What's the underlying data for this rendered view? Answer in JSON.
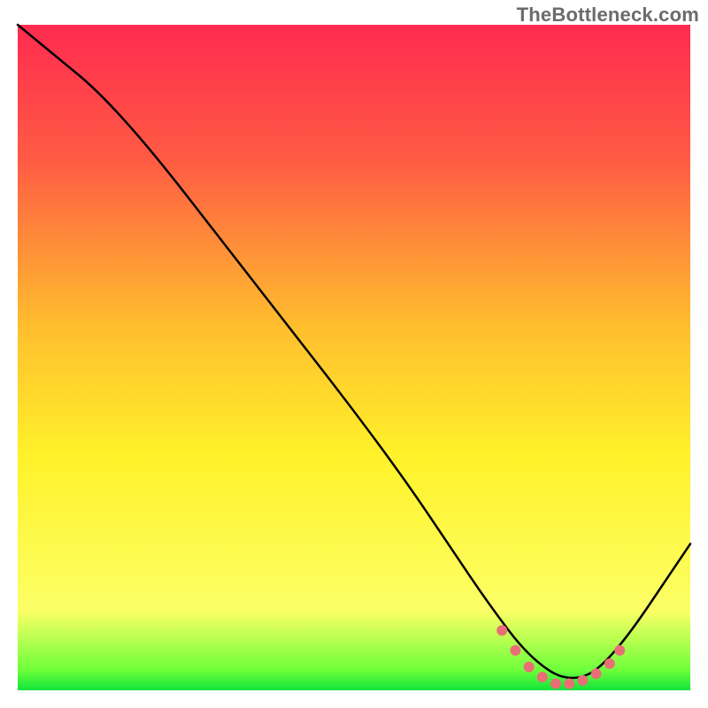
{
  "watermark": {
    "text": "TheBottleneck.com"
  },
  "chart_data": {
    "type": "line",
    "title": "",
    "xlabel": "",
    "ylabel": "",
    "xlim": [
      0,
      100
    ],
    "ylim": [
      0,
      100
    ],
    "gradient_stops": [
      {
        "offset": 0,
        "color": "#ff2b50"
      },
      {
        "offset": 20,
        "color": "#ff5a44"
      },
      {
        "offset": 45,
        "color": "#ffbd2e"
      },
      {
        "offset": 65,
        "color": "#fff22a"
      },
      {
        "offset": 88,
        "color": "#fcff66"
      },
      {
        "offset": 97,
        "color": "#6eff3a"
      },
      {
        "offset": 100,
        "color": "#10e43a"
      }
    ],
    "series": [
      {
        "name": "bottleneck-curve",
        "color": "#000000",
        "x": [
          0,
          6,
          12,
          20,
          30,
          40,
          50,
          58,
          64,
          70,
          76,
          82,
          88,
          100
        ],
        "y": [
          100,
          95,
          90,
          81,
          68,
          55,
          42,
          31,
          22,
          13,
          5,
          1,
          4,
          22
        ]
      },
      {
        "name": "highlight-band",
        "color": "#e96f77",
        "x": [
          72,
          74,
          76,
          78,
          80,
          82,
          84,
          86,
          88,
          89.5
        ],
        "y": [
          9,
          6,
          3.5,
          2,
          1,
          1,
          1.5,
          2.5,
          4,
          6
        ]
      }
    ],
    "annotations": []
  }
}
